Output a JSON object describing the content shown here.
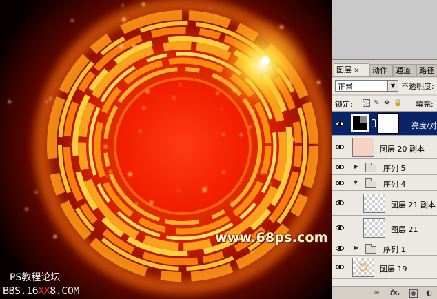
{
  "artwork": {
    "watermark_url": "www.68ps.com",
    "watermark_site": "PS教程论坛",
    "watermark_bbs_prefix": "BBS.16",
    "watermark_bbs_xx": "XX",
    "watermark_bbs_suffix": "8.COM",
    "colors": {
      "core": "#ff3a08",
      "ring": "#ffb000",
      "glow": "#ff6a00"
    }
  },
  "panel": {
    "tabs": [
      {
        "label": "图层",
        "active": true,
        "close": "×"
      },
      {
        "label": "动作",
        "active": false
      },
      {
        "label": "通道",
        "active": false
      },
      {
        "label": "路径",
        "active": false
      }
    ],
    "blend_mode": "正常",
    "opacity_label": "不透明度:",
    "lock_label": "锁定:",
    "fill_label": "填充:",
    "layers": [
      {
        "name": "亮度/对",
        "type": "adjustment",
        "selected": true,
        "visible": true
      },
      {
        "name": "图层 20 副本",
        "type": "pixel",
        "visible": true,
        "thumb": "#f3c0a8"
      },
      {
        "name": "序列 5",
        "type": "group",
        "expanded": false,
        "visible": true
      },
      {
        "name": "序列 4",
        "type": "group",
        "expanded": true,
        "visible": true
      },
      {
        "name": "图层 21 副本",
        "type": "pixel",
        "indent": true,
        "visible": true
      },
      {
        "name": "图层 21",
        "type": "pixel",
        "indent": true,
        "visible": true
      },
      {
        "name": "序列 1",
        "type": "group",
        "expanded": false,
        "visible": true
      },
      {
        "name": "图层 19",
        "type": "pixel",
        "visible": true,
        "thumb": "#f0b070"
      }
    ],
    "bottom_icons": [
      "link-icon",
      "fx-icon",
      "mask-icon",
      "adjustment-icon"
    ],
    "bottom_fx": "fx."
  }
}
